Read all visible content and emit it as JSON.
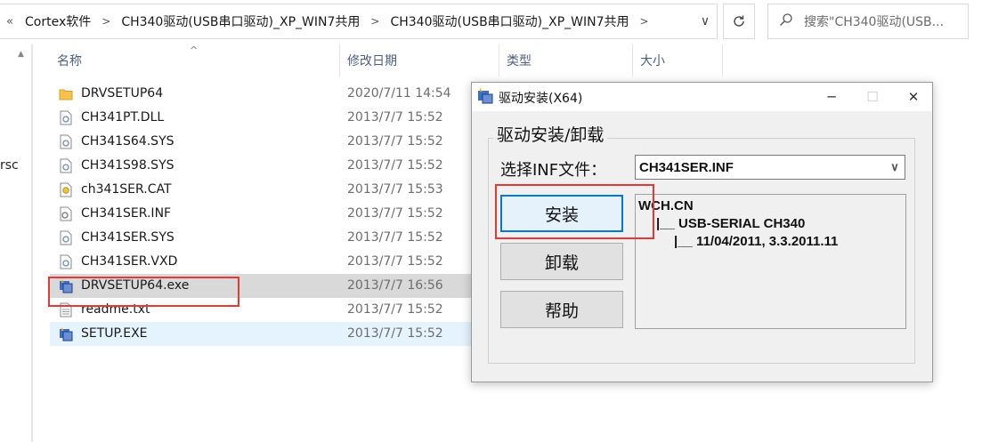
{
  "address_bar": {
    "overflow_icon": "«",
    "segments": [
      "Cortex软件",
      "CH340驱动(USB串口驱动)_XP_WIN7共用",
      "CH340驱动(USB串口驱动)_XP_WIN7共用"
    ],
    "separator_icon": "chevron-right-icon",
    "dropdown_icon": "chevron-down-icon"
  },
  "refresh_icon": "refresh-icon",
  "search": {
    "placeholder": "搜索\"CH340驱动(USB..."
  },
  "nav_pane": {
    "fragment_text": "rsc"
  },
  "columns": {
    "name": "名称",
    "modified": "修改日期",
    "type": "类型",
    "size": "大小"
  },
  "files": [
    {
      "name": "DRVSETUP64",
      "date": "2020/7/11 14:54",
      "icon": "folder-icon"
    },
    {
      "name": "CH341PT.DLL",
      "date": "2013/7/7 15:52",
      "icon": "dll-file-icon"
    },
    {
      "name": "CH341S64.SYS",
      "date": "2013/7/7 15:52",
      "icon": "sys-file-icon"
    },
    {
      "name": "CH341S98.SYS",
      "date": "2013/7/7 15:52",
      "icon": "sys-file-icon"
    },
    {
      "name": "ch341SER.CAT",
      "date": "2013/7/7 15:53",
      "icon": "security-catalog-icon"
    },
    {
      "name": "CH341SER.INF",
      "date": "2013/7/7 15:52",
      "icon": "inf-file-icon"
    },
    {
      "name": "CH341SER.SYS",
      "date": "2013/7/7 15:52",
      "icon": "sys-file-icon"
    },
    {
      "name": "CH341SER.VXD",
      "date": "2013/7/7 15:52",
      "icon": "sys-file-icon"
    },
    {
      "name": "DRVSETUP64.exe",
      "date": "2013/7/7 16:56",
      "icon": "installer-exe-icon"
    },
    {
      "name": "readme.txt",
      "date": "2013/7/7 15:52",
      "icon": "text-file-icon"
    },
    {
      "name": "SETUP.EXE",
      "date": "2013/7/7 15:52",
      "icon": "installer-exe-icon"
    }
  ],
  "dialog": {
    "title": "驱动安装(X64)",
    "minimize_icon": "minimize-icon",
    "maximize_icon": "maximize-icon",
    "close_icon": "close-icon",
    "group_label": "驱动安装/卸载",
    "inf_label": "选择INF文件：",
    "inf_value": "CH341SER.INF",
    "install_label": "安装",
    "uninstall_label": "卸载",
    "help_label": "帮助",
    "info_lines": [
      "WCH.CN",
      "|__ USB-SERIAL CH340",
      "|__ 11/04/2011, 3.3.2011.11"
    ]
  },
  "colors": {
    "highlight": "#e53935",
    "selected_row": "#d9d9d9",
    "hover_row": "#e5f3ff",
    "default_button_border": "#0078d7"
  }
}
